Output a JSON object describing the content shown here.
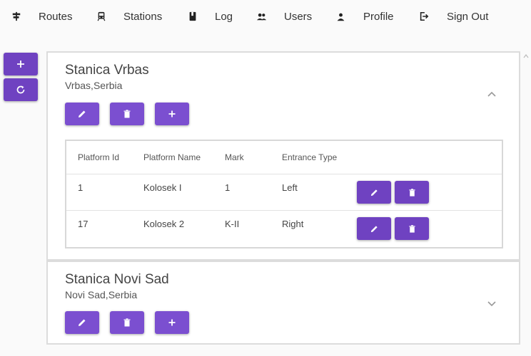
{
  "nav": {
    "routes": "Routes",
    "stations": "Stations",
    "log": "Log",
    "users": "Users",
    "profile": "Profile",
    "sign_out": "Sign Out"
  },
  "side": {
    "add_icon": "plus-icon",
    "refresh_icon": "refresh-icon"
  },
  "stations": [
    {
      "name": "Stanica Vrbas",
      "location": "Vrbas,Serbia",
      "expanded": true,
      "table": {
        "headers": [
          "Platform Id",
          "Platform Name",
          "Mark",
          "Entrance Type"
        ],
        "rows": [
          {
            "id": "1",
            "name": "Kolosek I",
            "mark": "1",
            "entrance": "Left"
          },
          {
            "id": "17",
            "name": "Kolosek 2",
            "mark": "K-II",
            "entrance": "Right"
          }
        ]
      }
    },
    {
      "name": "Stanica Novi Sad",
      "location": "Novi Sad,Serbia",
      "expanded": false
    }
  ],
  "colors": {
    "accent": "#6f42c1",
    "accent_light": "#7b4fd0"
  }
}
